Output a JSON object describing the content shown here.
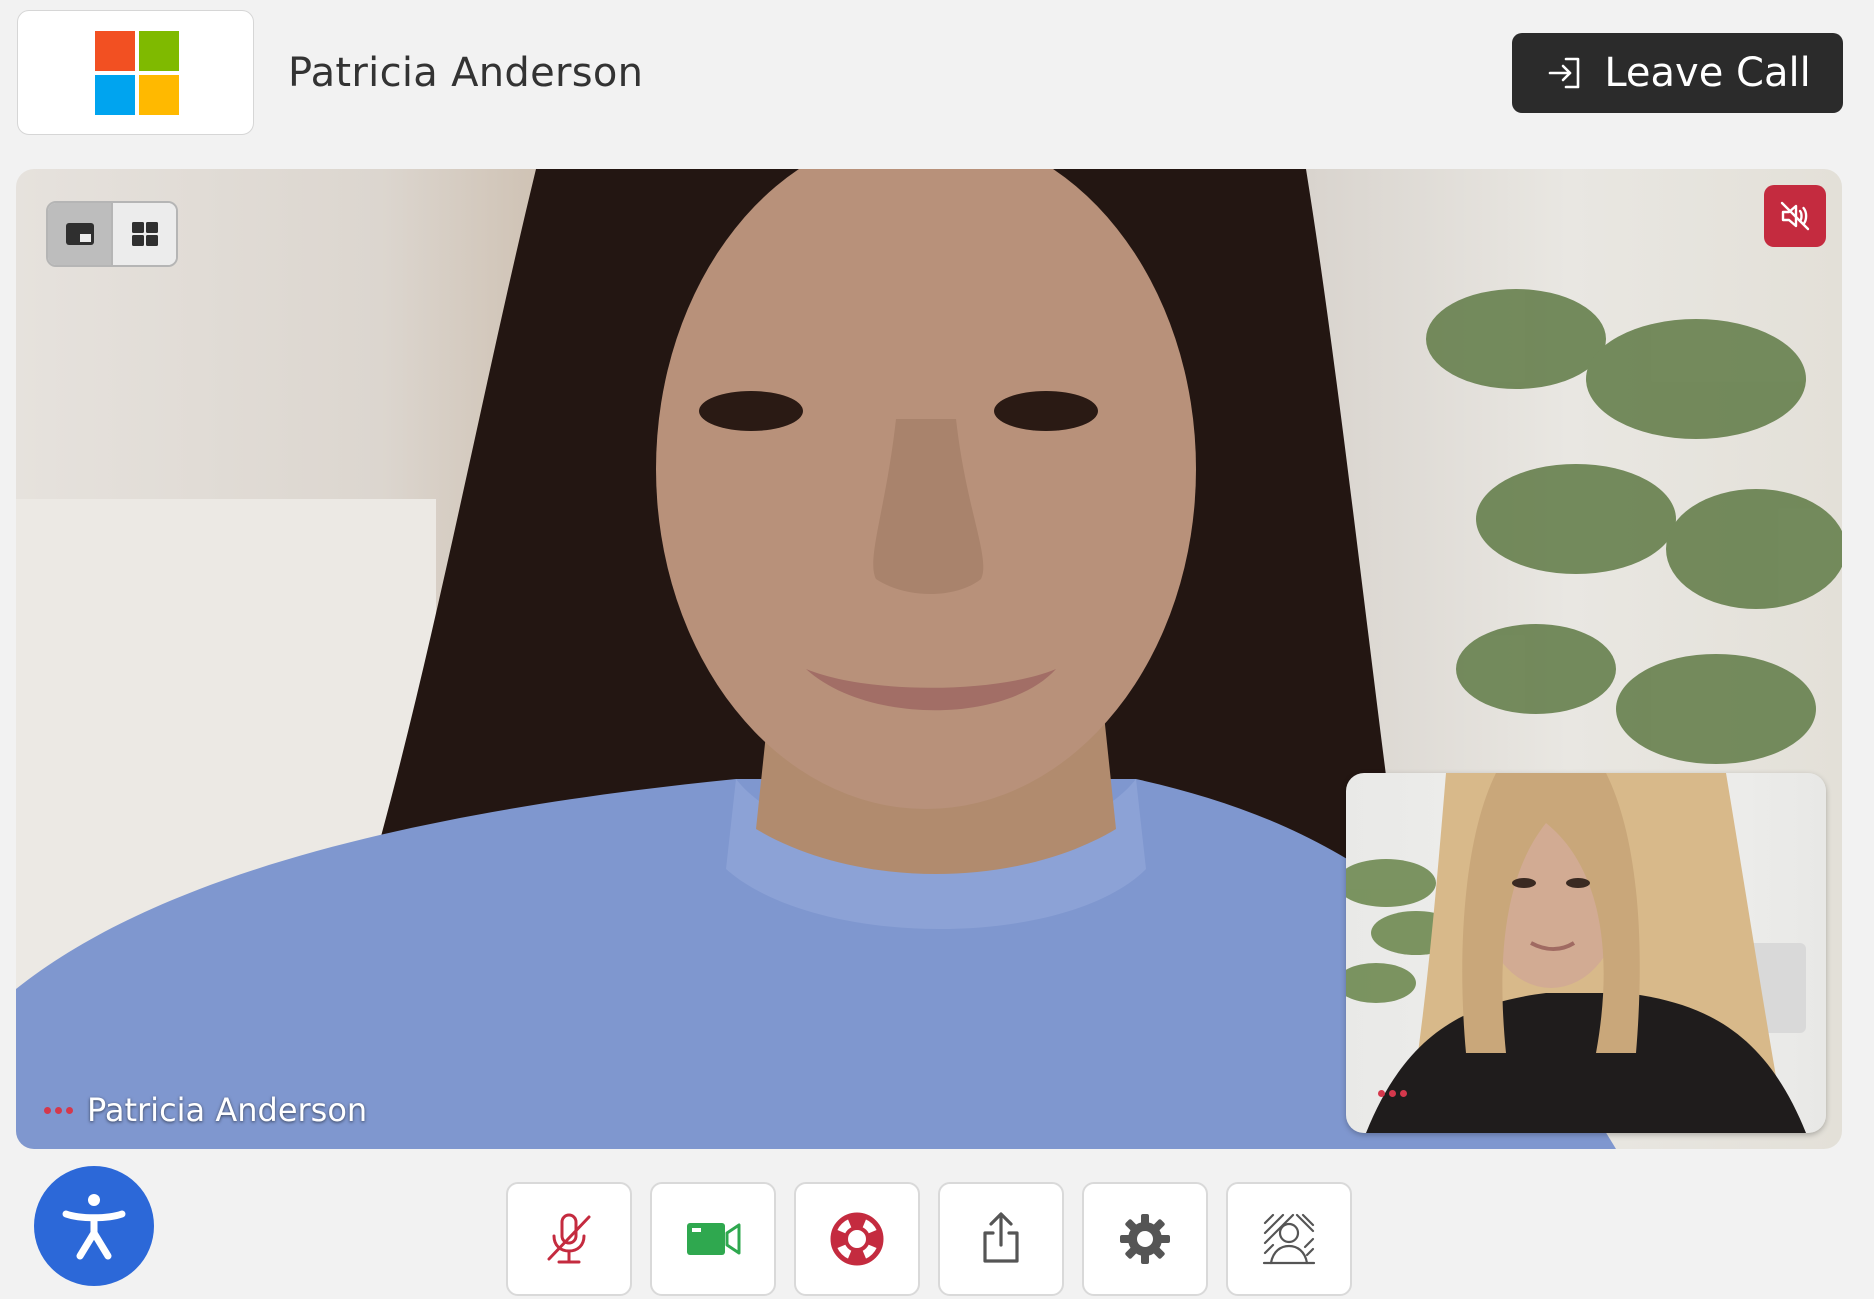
{
  "header": {
    "brand_icon": "microsoft-logo",
    "caller_name": "Patricia Anderson",
    "leave_label": "Leave Call",
    "leave_icon": "exit-icon"
  },
  "main_video": {
    "participant_name": "Patricia Anderson",
    "muted_icon": "speaker-muted-icon",
    "layout_options": [
      {
        "icon": "spotlight-layout-icon",
        "active": true
      },
      {
        "icon": "grid-layout-icon",
        "active": false
      }
    ]
  },
  "self_view": {
    "menu_icon": "more-dots-icon"
  },
  "accessibility": {
    "icon": "accessibility-icon"
  },
  "controls": [
    {
      "icon": "microphone-off-icon",
      "color": "#c42b3f"
    },
    {
      "icon": "video-camera-icon",
      "color": "#2fa84f"
    },
    {
      "icon": "lifebuoy-icon",
      "color": "#c42b3f"
    },
    {
      "icon": "share-icon",
      "color": "#555555"
    },
    {
      "icon": "settings-gear-icon",
      "color": "#555555"
    },
    {
      "icon": "background-blur-icon",
      "color": "#555555"
    }
  ],
  "colors": {
    "accent_red": "#c42b3f",
    "dark_button": "#2b2b2b",
    "accessibility_blue": "#2c68d8",
    "camera_green": "#2fa84f"
  }
}
